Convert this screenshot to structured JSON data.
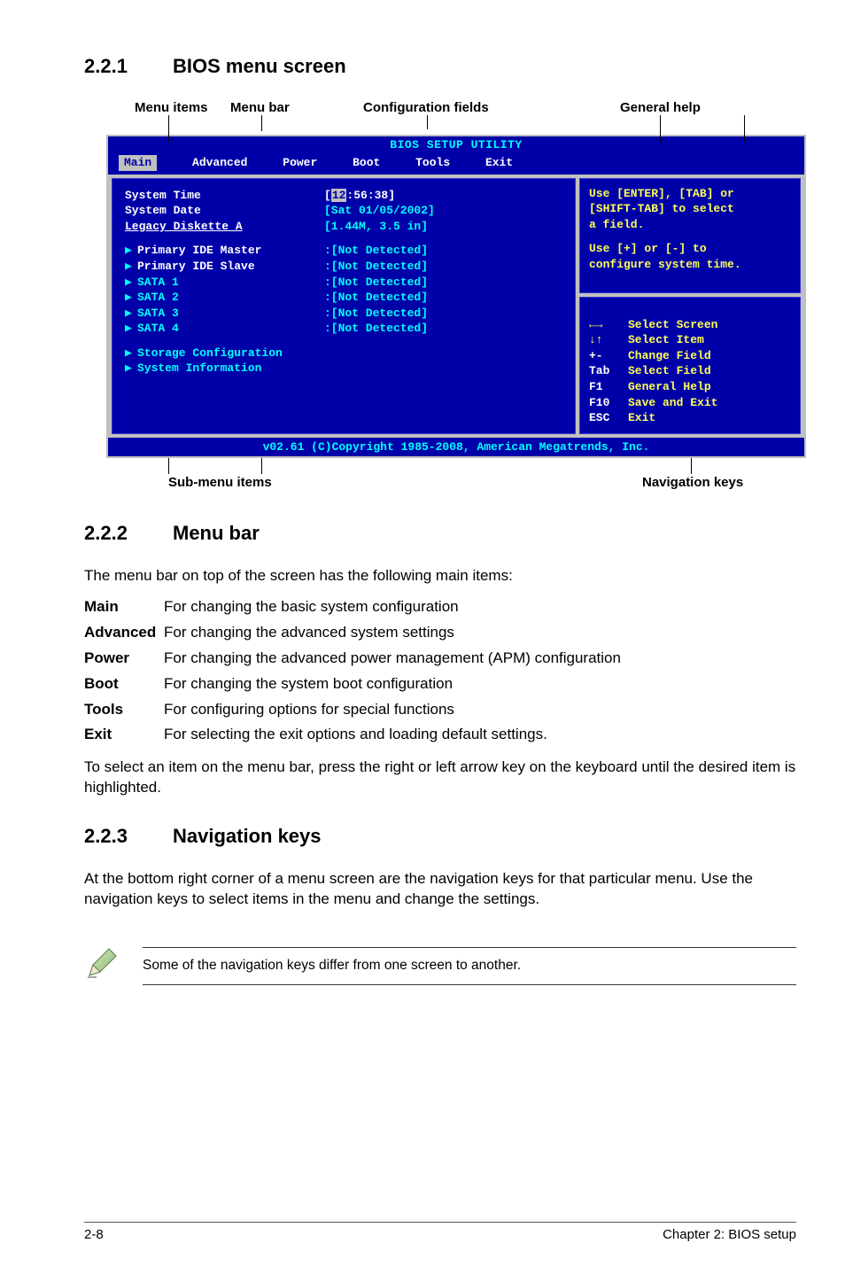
{
  "sections": {
    "s1": {
      "num": "2.2.1",
      "title": "BIOS menu screen"
    },
    "s2": {
      "num": "2.2.2",
      "title": "Menu bar"
    },
    "s3": {
      "num": "2.2.3",
      "title": "Navigation keys"
    }
  },
  "diagram_labels": {
    "menu_items": "Menu items",
    "menu_bar": "Menu bar",
    "config_fields": "Configuration fields",
    "general_help": "General help",
    "submenu_items": "Sub-menu items",
    "nav_keys": "Navigation keys"
  },
  "bios": {
    "title": "BIOS SETUP UTILITY",
    "menus": {
      "main": "Main",
      "advanced": "Advanced",
      "power": "Power",
      "boot": "Boot",
      "tools": "Tools",
      "exit": "Exit"
    },
    "left": {
      "system_time": "System Time",
      "system_date": "System Date",
      "legacy": "Legacy Diskette A",
      "time_sel": "12",
      "time_rest": ":56:38]",
      "date": "[Sat 01/05/2002]",
      "floppy": "[1.44M, 3.5 in]",
      "pide_m": "Primary IDE Master",
      "pide_s": "Primary IDE Slave",
      "sata1": "SATA 1",
      "sata2": "SATA 2",
      "sata3": "SATA 3",
      "sata4": "SATA 4",
      "nd": ":[Not Detected]",
      "storage": "Storage Configuration",
      "sysinfo": "System Information"
    },
    "help": {
      "l1": "Use [ENTER], [TAB] or",
      "l2": "[SHIFT-TAB] to select",
      "l3": "a field.",
      "l4": "Use [+] or [-] to",
      "l5": "configure system time."
    },
    "nav": {
      "k1": "←→",
      "d1": "Select Screen",
      "k2": "↓↑",
      "d2": "Select Item",
      "k3": "+-",
      "d3": "Change Field",
      "k4": "Tab",
      "d4": "Select Field",
      "k5": "F1",
      "d5": "General Help",
      "k6": "F10",
      "d6": "Save and Exit",
      "k7": "ESC",
      "d7": "Exit"
    },
    "footer": "v02.61 (C)Copyright 1985-2008, American Megatrends, Inc."
  },
  "menubar_section": {
    "intro": "The menu bar on top of the screen has the following main items:",
    "items": {
      "main": {
        "t": "Main",
        "d": "For changing the basic system configuration"
      },
      "advanced": {
        "t": "Advanced",
        "d": "For changing the advanced system settings"
      },
      "power": {
        "t": "Power",
        "d": "For changing the advanced power management (APM) configuration"
      },
      "boot": {
        "t": "Boot",
        "d": "For changing the system boot configuration"
      },
      "tools": {
        "t": "Tools",
        "d": "For configuring options for special functions"
      },
      "exit": {
        "t": "Exit",
        "d": "For selecting the exit options and loading default settings."
      }
    },
    "outro": "To select an item on the menu bar, press the right or left arrow key on the keyboard until the desired item is highlighted."
  },
  "navkeys_section": {
    "p": "At the bottom right corner of a menu screen are the navigation keys for that particular menu. Use the navigation keys to select items in the menu and change the settings."
  },
  "note": "Some of the navigation keys differ from one screen to another.",
  "footer": {
    "left": "2-8",
    "right": "Chapter 2: BIOS setup"
  }
}
